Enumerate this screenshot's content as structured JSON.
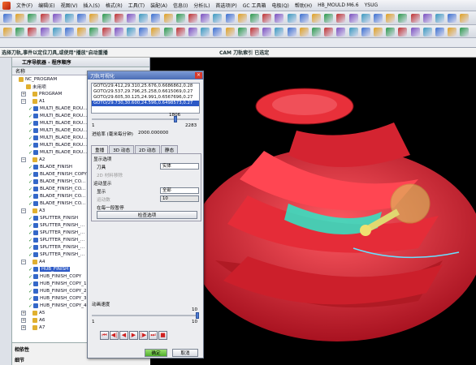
{
  "menubar": {
    "items": [
      "文件(F)",
      "编辑(E)",
      "视图(V)",
      "插入(S)",
      "格式(R)",
      "工具(T)",
      "装配(A)",
      "信息(I)",
      "分析(L)",
      "首选项(P)",
      "GC 工具箱",
      "电极(Q)",
      "帮助(H)",
      "HB_MOULD M6.6",
      "YSUG"
    ]
  },
  "cue": {
    "left": "选择刀轨,事件以定位刀具,或使用\"播放\"启动重播",
    "right": "CAM 刀轨索引 已选定"
  },
  "navigator": {
    "title": "工序导航器 - 程序顺序",
    "column": "名称",
    "rows": [
      {
        "label": "NC_PROGRAM",
        "indent": 0,
        "toggle": ""
      },
      {
        "label": "未用项",
        "indent": 1,
        "toggle": ""
      },
      {
        "label": "PROGRAM",
        "indent": 1,
        "toggle": "+"
      },
      {
        "label": "A1",
        "indent": 1,
        "toggle": "−"
      },
      {
        "label": "MULTI_BLADE_ROU...",
        "indent": 2,
        "toggle": ""
      },
      {
        "label": "MULTI_BLADE_ROU...",
        "indent": 2,
        "toggle": ""
      },
      {
        "label": "MULTI_BLADE_ROU...",
        "indent": 2,
        "toggle": ""
      },
      {
        "label": "MULTI_BLADE_ROU...",
        "indent": 2,
        "toggle": ""
      },
      {
        "label": "MULTI_BLADE_ROU...",
        "indent": 2,
        "toggle": ""
      },
      {
        "label": "MULTI_BLADE_ROU...",
        "indent": 2,
        "toggle": ""
      },
      {
        "label": "MULTI_BLADE_ROU...",
        "indent": 2,
        "toggle": ""
      },
      {
        "label": "A2",
        "indent": 1,
        "toggle": "−"
      },
      {
        "label": "BLADE_FINISH",
        "indent": 2,
        "toggle": ""
      },
      {
        "label": "BLADE_FINISH_COPY",
        "indent": 2,
        "toggle": ""
      },
      {
        "label": "BLADE_FINISH_CO...",
        "indent": 2,
        "toggle": ""
      },
      {
        "label": "BLADE_FINISH_CO...",
        "indent": 2,
        "toggle": ""
      },
      {
        "label": "BLADE_FINISH_CO...",
        "indent": 2,
        "toggle": ""
      },
      {
        "label": "BLADE_FINISH_CO...",
        "indent": 2,
        "toggle": ""
      },
      {
        "label": "A3",
        "indent": 1,
        "toggle": "−"
      },
      {
        "label": "SPLITTER_FINISH",
        "indent": 2,
        "toggle": ""
      },
      {
        "label": "SPLITTER_FINISH_...",
        "indent": 2,
        "toggle": ""
      },
      {
        "label": "SPLITTER_FINISH_...",
        "indent": 2,
        "toggle": ""
      },
      {
        "label": "SPLITTER_FINISH_...",
        "indent": 2,
        "toggle": ""
      },
      {
        "label": "SPLITTER_FINISH_...",
        "indent": 2,
        "toggle": ""
      },
      {
        "label": "SPLITTER_FINISH_...",
        "indent": 2,
        "toggle": ""
      },
      {
        "label": "A4",
        "indent": 1,
        "toggle": "−"
      },
      {
        "label": "HUB_FINISH",
        "indent": 2,
        "toggle": "",
        "selected": true
      },
      {
        "label": "HUB_FINISH_COPY",
        "indent": 2,
        "toggle": ""
      },
      {
        "label": "HUB_FINISH_COPY_1",
        "indent": 2,
        "toggle": ""
      },
      {
        "label": "HUB_FINISH_COPY_2",
        "indent": 2,
        "toggle": ""
      },
      {
        "label": "HUB_FINISH_COPY_3",
        "indent": 2,
        "toggle": ""
      },
      {
        "label": "HUB_FINISH_COPY_4",
        "indent": 2,
        "toggle": ""
      },
      {
        "label": "A5",
        "indent": 1,
        "toggle": "+"
      },
      {
        "label": "A6",
        "indent": 1,
        "toggle": "+"
      },
      {
        "label": "A7",
        "indent": 1,
        "toggle": "+"
      }
    ],
    "bottom": [
      "相依性",
      "细节"
    ]
  },
  "dialog": {
    "title": "刀轨可视化",
    "close": "×",
    "goto": [
      "GOTO/29.412,29.310,25.676,0.6686862,0.28",
      "GOTO/29.537,29.796,25.258,0.6615069,0.27",
      "GOTO/29.605,30.125,24.991,0.6567696,0.27",
      "GOTO/29.730,30.600,24.596,0.6498573,0.27"
    ],
    "goto_selected": 3,
    "slider1": {
      "min": "1",
      "max": "2283",
      "value": "1806",
      "fraction": 0.79
    },
    "motion_label": "进给率 (毫米每分钟)",
    "motion_value": "2000.000000",
    "tabs": [
      "重播",
      "3D 动态",
      "2D 动态",
      "静态"
    ],
    "active_tab": 0,
    "display_options": "显示选项",
    "tool_label": "刀具",
    "tool_value": "实体",
    "stock_label": "2D 材料移除",
    "motion_display": "运动显示",
    "display_label": "显示",
    "display_value": "全部",
    "motion_count_label": "运动数",
    "motion_count_value": "10",
    "pause_label": "在每一段暂停",
    "check_button": "检查选项",
    "speed_label": "动画速度",
    "speed": {
      "min": "1",
      "max": "10",
      "value": "10",
      "fraction": 1.0
    },
    "ok": "确定",
    "cancel": "取消"
  },
  "colors": {
    "impeller": "#e8303a",
    "hub_path": "#2ee8c8",
    "tool": "#d8d060",
    "selection": "#2b58c6"
  }
}
